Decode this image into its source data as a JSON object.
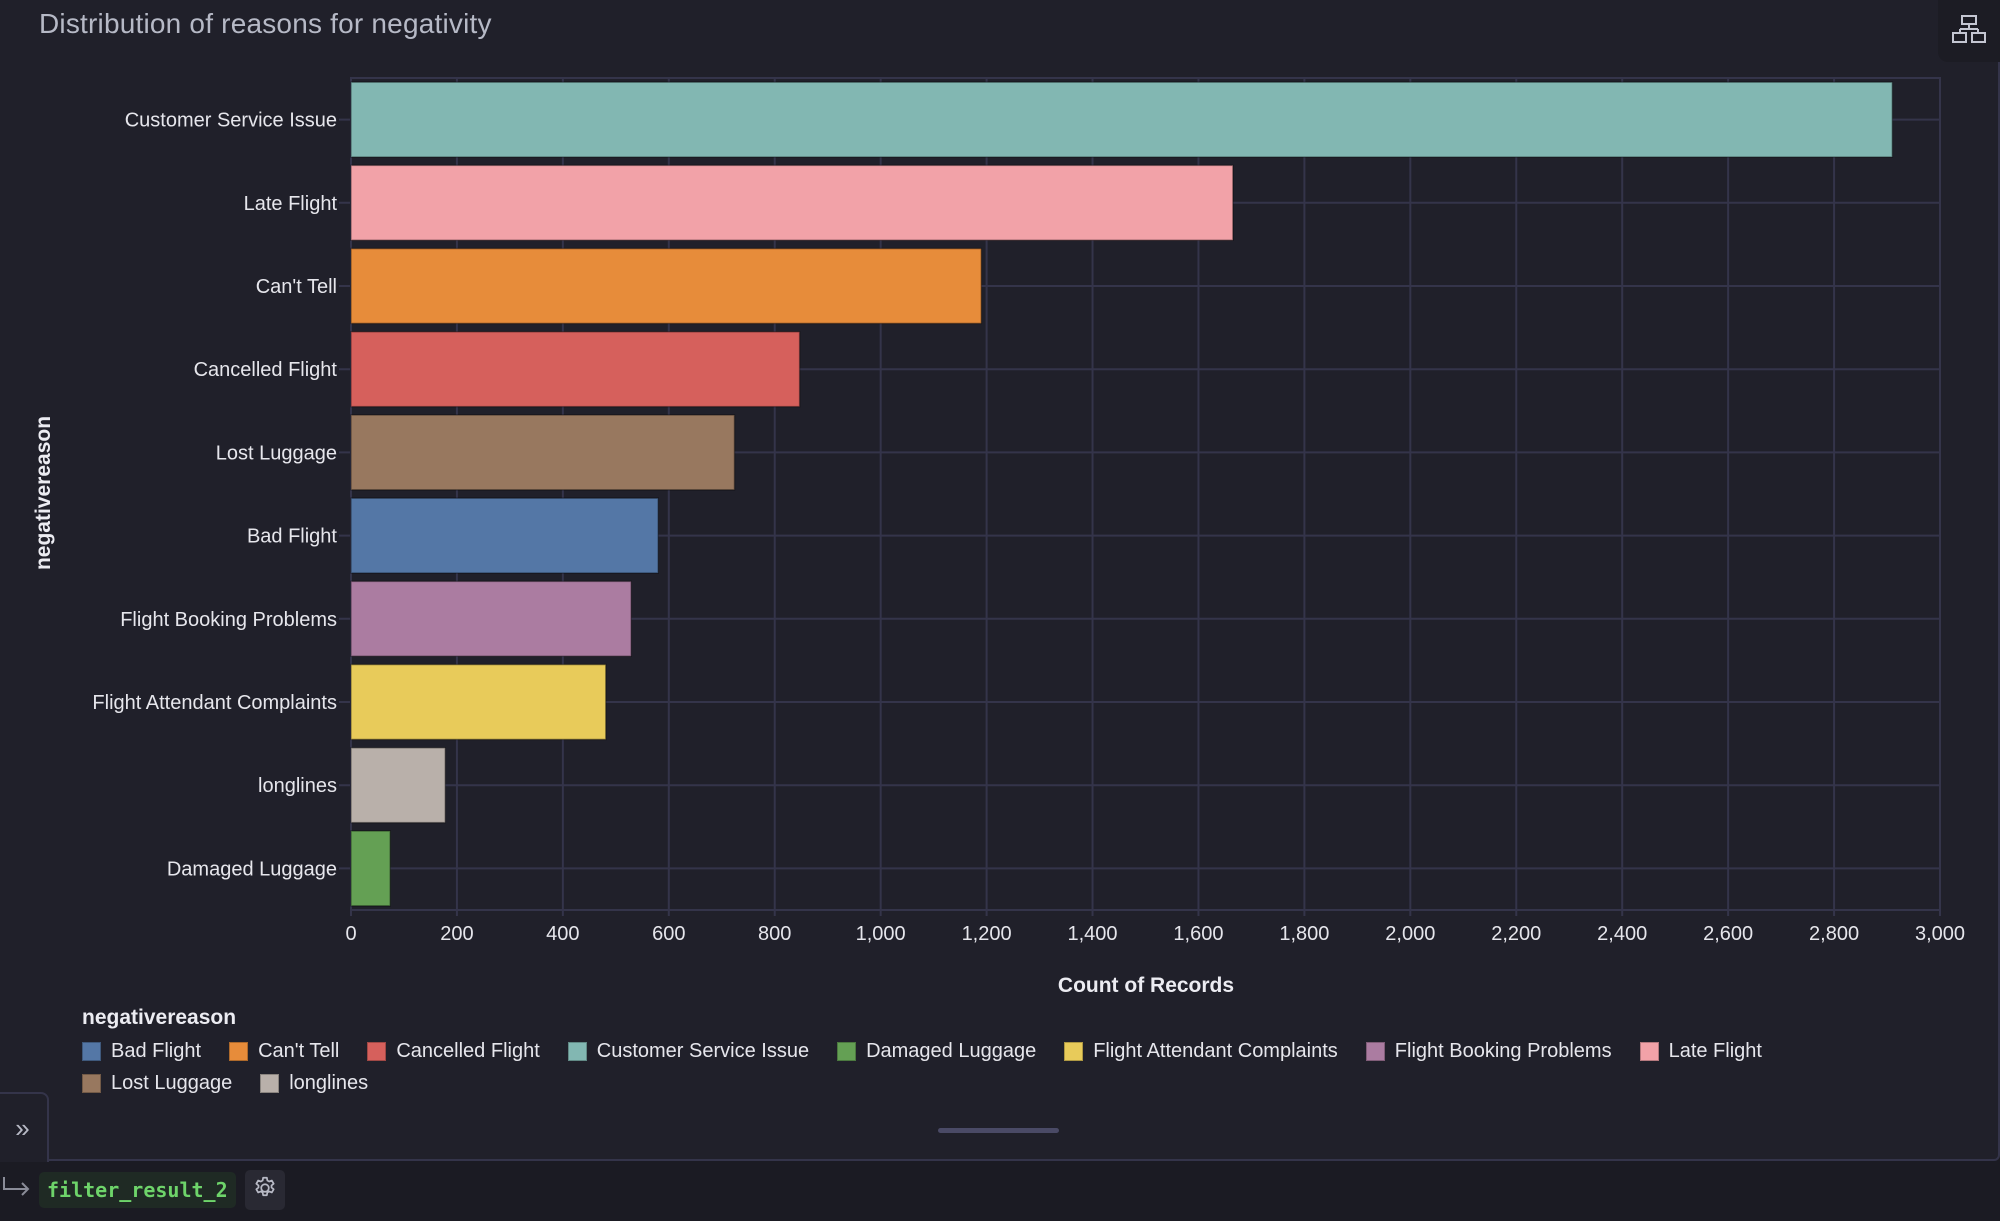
{
  "header": {
    "title": "Distribution of reasons for negativity",
    "corner_button_icon": "hierarchy-icon"
  },
  "chart_data": {
    "type": "bar",
    "orientation": "horizontal",
    "title": "Distribution of reasons for negativity",
    "xlabel": "Count of Records",
    "ylabel": "negativereason",
    "xlim": [
      0,
      3000
    ],
    "x_ticks": [
      0,
      200,
      400,
      600,
      800,
      1000,
      1200,
      1400,
      1600,
      1800,
      2000,
      2200,
      2400,
      2600,
      2800,
      3000
    ],
    "x_tick_labels": [
      "0",
      "200",
      "400",
      "600",
      "800",
      "1,000",
      "1,200",
      "1,400",
      "1,600",
      "1,800",
      "2,000",
      "2,200",
      "2,400",
      "2,600",
      "2,800",
      "3,000"
    ],
    "grid": true,
    "categories": [
      "Customer Service Issue",
      "Late Flight",
      "Can't Tell",
      "Cancelled Flight",
      "Lost Luggage",
      "Bad Flight",
      "Flight Booking Problems",
      "Flight Attendant Complaints",
      "longlines",
      "Damaged Luggage"
    ],
    "values": [
      2910,
      1665,
      1190,
      847,
      724,
      580,
      529,
      481,
      178,
      74
    ],
    "colors": {
      "Customer Service Issue": "#82b7b2",
      "Late Flight": "#f2a2a8",
      "Can't Tell": "#e78c3a",
      "Cancelled Flight": "#d6605c",
      "Lost Luggage": "#98785f",
      "Bad Flight": "#5477a6",
      "Flight Booking Problems": "#ab7ca1",
      "Flight Attendant Complaints": "#e8cb5a",
      "longlines": "#b9b0aa",
      "Damaged Luggage": "#64a054"
    },
    "legend": {
      "title": "negativereason",
      "placement": "bottom-left",
      "entries": [
        "Bad Flight",
        "Can't Tell",
        "Cancelled Flight",
        "Customer Service Issue",
        "Damaged Luggage",
        "Flight Attendant Complaints",
        "Flight Booking Problems",
        "Late Flight",
        "Lost Luggage",
        "longlines"
      ]
    }
  },
  "footer": {
    "return_icon": "return-arrow-icon",
    "result_name": "filter_result_2",
    "settings_icon": "gear-icon"
  },
  "sidebar_toggle": {
    "icon": "double-chevron-right-icon"
  }
}
